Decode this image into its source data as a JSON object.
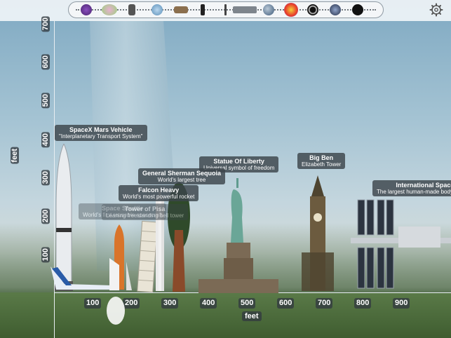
{
  "objects": [
    {
      "name": "SpaceX Mars Vehicle",
      "sub": "\"Interplanetary Transport System\""
    },
    {
      "name": "Statue Of Liberty",
      "sub": "Universal symbol of freedom"
    },
    {
      "name": "Big Ben",
      "sub": "Elizabeth Tower"
    },
    {
      "name": "General Sherman Sequoia",
      "sub": "World's largest tree"
    },
    {
      "name": "Falcon Heavy",
      "sub": "World's most powerful rocket"
    },
    {
      "name": "Space Shuttle",
      "sub": "World's first reusable spacecraft"
    },
    {
      "name": "Tower of Pisa",
      "sub": "Leaning freestanding bell tower"
    },
    {
      "name": "International Space Station",
      "sub": "The largest human-made body in low Earth orbit"
    }
  ],
  "x_axis": {
    "label": "feet",
    "ticks": [
      "100",
      "200",
      "300",
      "400",
      "500",
      "600",
      "700",
      "800",
      "900"
    ]
  },
  "y_axis": {
    "label": "feet",
    "ticks": [
      "100",
      "200",
      "300",
      "400",
      "500",
      "600",
      "700"
    ]
  }
}
